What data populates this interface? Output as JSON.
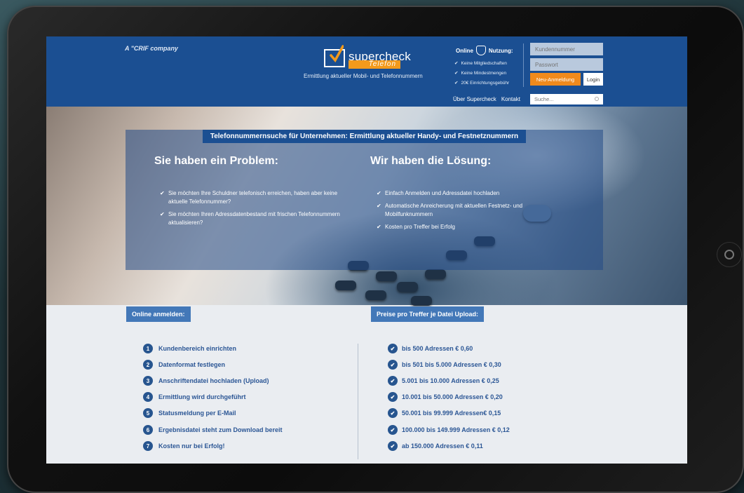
{
  "header": {
    "crif": "A \"CRIF company",
    "logo_word": "supercheck",
    "logo_sub": "Telefon",
    "tagline": "Ermittlung aktueller Mobil- und Telefonnummern",
    "online_label": "Online",
    "usage_label": "Nutzung:",
    "benefits": [
      "Keine Mitgliedschaften",
      "Keine Mindestmengen",
      "20€ Einrichtungsgebühr"
    ],
    "customer_placeholder": "Kundennummer",
    "password_placeholder": "Passwort",
    "new_registration": "Neu-Anmeldung",
    "login": "Login",
    "nav": [
      "Über Supercheck",
      "Kontakt"
    ],
    "search_placeholder": "Suche..."
  },
  "hero": {
    "banner": "Telefonnummernsuche für Unternehmen: Ermittlung aktueller Handy- und Festnetznummern",
    "problem_title": "Sie haben ein Problem:",
    "problems": [
      "Sie möchten Ihre Schuldner telefonisch erreichen, haben aber keine aktuelle Telefonnummer?",
      "Sie möchten Ihren Adressdatenbestand mit frischen Telefonnummern aktualisieren?"
    ],
    "solution_title": "Wir haben die Lösung:",
    "solutions": [
      "Einfach Anmelden und Adressdatei hochladen",
      "Automatische Anreicherung mit aktuellen Festnetz- und Mobilfunknummern",
      "Kosten pro Treffer bei Erfolg"
    ]
  },
  "register": {
    "title": "Online anmelden:",
    "steps": [
      {
        "n": "1",
        "text": "Kundenbereich einrichten"
      },
      {
        "n": "2",
        "text": "Datenformat festlegen"
      },
      {
        "n": "3",
        "text": "Anschriftendatei hochladen (Upload)"
      },
      {
        "n": "4",
        "text": "Ermittlung wird durchgeführt"
      },
      {
        "n": "5",
        "text": "Statusmeldung per E-Mail"
      },
      {
        "n": "6",
        "text": "Ergebnisdatei steht zum Download bereit"
      },
      {
        "n": "7",
        "text": "Kosten nur bei Erfolg!"
      }
    ]
  },
  "prices": {
    "title": "Preise pro Treffer je Datei Upload:",
    "items": [
      "bis 500 Adressen € 0,60",
      "bis 501 bis 5.000 Adressen € 0,30",
      "5.001 bis 10.000 Adressen € 0,25",
      "10.001 bis 50.000 Adressen € 0,20",
      "50.001 bis 99.999 Adressen€ 0,15",
      "100.000 bis 149.999 Adressen € 0,12",
      "ab 150.000 Adressen € 0,11"
    ]
  },
  "colors": {
    "header_blue": "#1b4f92",
    "accent_orange": "#f08a1c",
    "text_blue": "#2b5695"
  }
}
